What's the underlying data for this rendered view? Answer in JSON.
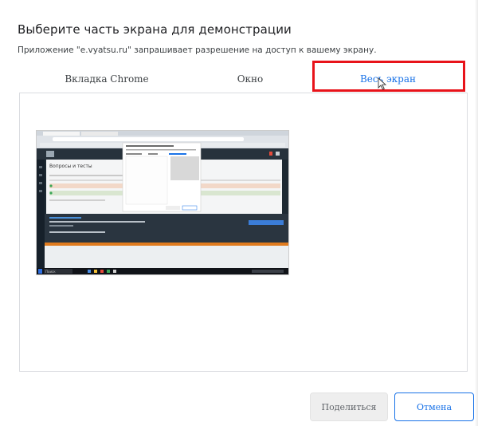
{
  "dialog": {
    "title": "Выберите часть экрана для демонстрации",
    "subtitle": "Приложение \"e.vyatsu.ru\" запрашивает разрешение на доступ к вашему экрану."
  },
  "tabs": [
    {
      "label": "Вкладка Chrome",
      "selected": false
    },
    {
      "label": "Окно",
      "selected": false
    },
    {
      "label": "Весь экран",
      "selected": true
    }
  ],
  "preview": {
    "screen_banner": "Вопросы и тесты",
    "taskbar_search": "Поиск"
  },
  "buttons": {
    "share_label": "Поделиться",
    "cancel_label": "Отмена"
  },
  "colors": {
    "accent": "#1a73e8",
    "highlight": "#e8131a",
    "share_bg": "#eeeeee"
  },
  "icons": {
    "cursor": "mouse-pointer-icon"
  }
}
